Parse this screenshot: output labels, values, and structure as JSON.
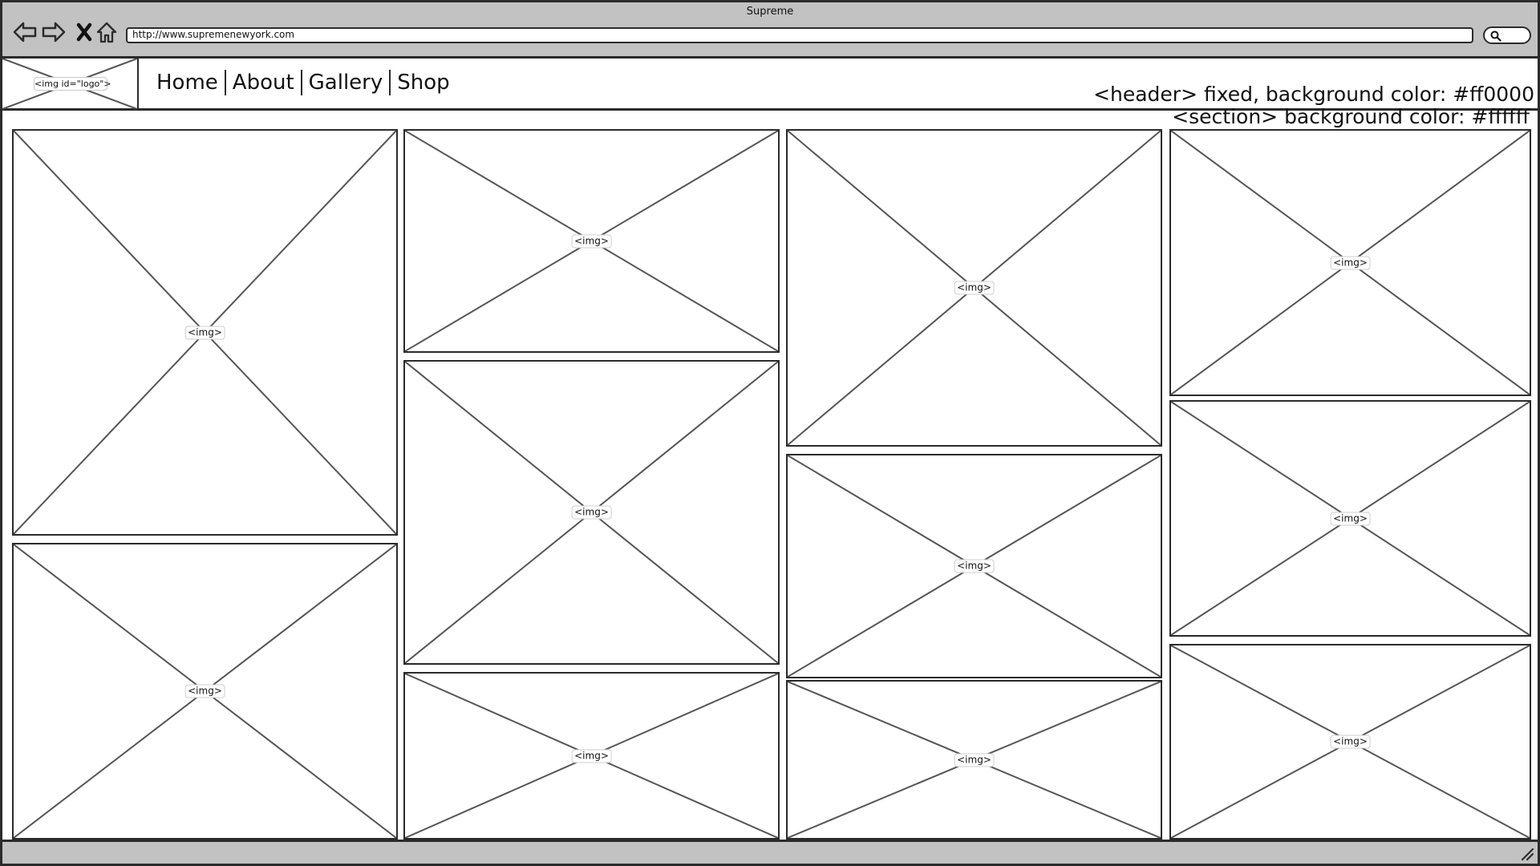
{
  "browser": {
    "title": "Supreme",
    "url": "http://www.supremenewyork.com",
    "icons": {
      "back": "back-arrow-icon",
      "forward": "forward-arrow-icon",
      "stop": "stop-x-icon",
      "home": "home-icon",
      "search": "search-icon"
    }
  },
  "header": {
    "logo_label": "<img id=\"logo\">",
    "nav": [
      {
        "label": "Home"
      },
      {
        "label": "About"
      },
      {
        "label": "Gallery"
      },
      {
        "label": "Shop"
      }
    ],
    "annotation": "<header> fixed, background color: #ff0000"
  },
  "section": {
    "annotation": "<section> background color: #ffffff"
  },
  "gallery": {
    "image_label": "<img>",
    "image_count": 11
  },
  "colors": {
    "chrome": "#c2c2c2",
    "outline": "#2b2b2b",
    "page": "#ffffff"
  }
}
